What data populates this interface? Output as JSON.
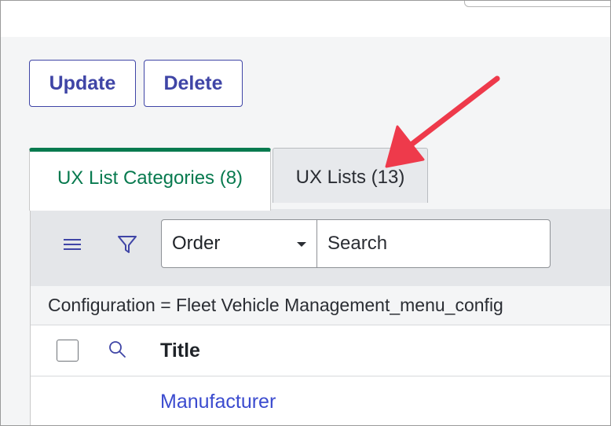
{
  "actions": {
    "update_label": "Update",
    "delete_label": "Delete"
  },
  "tabs": [
    {
      "label": "UX List Categories (8)",
      "active": true
    },
    {
      "label": "UX Lists (13)",
      "active": false
    }
  ],
  "toolbar": {
    "menu_icon": "hamburger-menu-icon",
    "filter_icon": "funnel-filter-icon",
    "select_value": "Order",
    "search_placeholder": "Search"
  },
  "filter_breadcrumb": "Configuration = Fleet Vehicle Management_menu_config",
  "table": {
    "columns": [
      "Title"
    ],
    "rows": [
      {
        "title": "Manufacturer"
      }
    ]
  },
  "colors": {
    "accent": "#3f45a6",
    "active_tab": "#087a4f",
    "link": "#3b4bcf",
    "annotation_arrow": "#ee3a4b"
  }
}
